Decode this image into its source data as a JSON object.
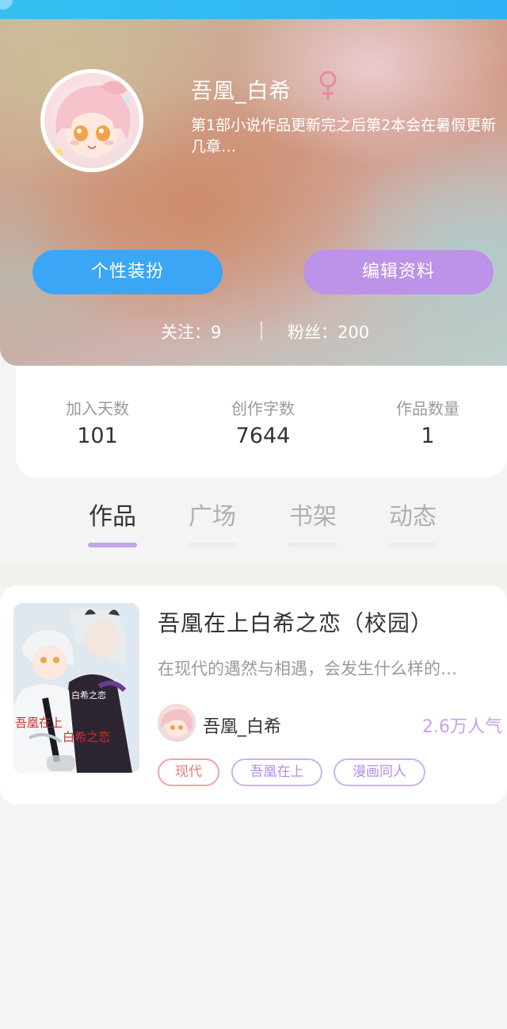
{
  "profile": {
    "username": "吾凰_白希",
    "gender_icon": "female-icon",
    "bio": "第1部小说作品更新完之后第2本会在暑假更新几章…",
    "buttons": {
      "dress_up": "个性装扮",
      "edit_profile": "编辑资料"
    },
    "follow_label": "关注：9",
    "fans_label": "粉丝：200"
  },
  "stats": [
    {
      "label": "加入天数",
      "value": "101"
    },
    {
      "label": "创作字数",
      "value": "7644"
    },
    {
      "label": "作品数量",
      "value": "1"
    }
  ],
  "tabs": [
    {
      "label": "作品",
      "active": true
    },
    {
      "label": "广场",
      "active": false
    },
    {
      "label": "书架",
      "active": false
    },
    {
      "label": "动态",
      "active": false
    }
  ],
  "work": {
    "title": "吾凰在上白希之恋（校园）",
    "description": "在现代的遇然与相遇，会发生什么样的…",
    "author": "吾凰_白希",
    "popularity": "2.6万人气",
    "cover_text_1": "白希之恋",
    "cover_text_2": "吾凰在上",
    "cover_text_3": "白希之恋",
    "tags": [
      "现代",
      "吾凰在上",
      "漫画同人"
    ]
  },
  "colors": {
    "accent_blue": "#3aa6f5",
    "accent_purple": "#bc93e8",
    "tab_indicator": "#c1a6ea",
    "female_pink": "#e98aa2",
    "tag_red": "#e9787c",
    "popularity_purple": "#c5a3ea"
  }
}
